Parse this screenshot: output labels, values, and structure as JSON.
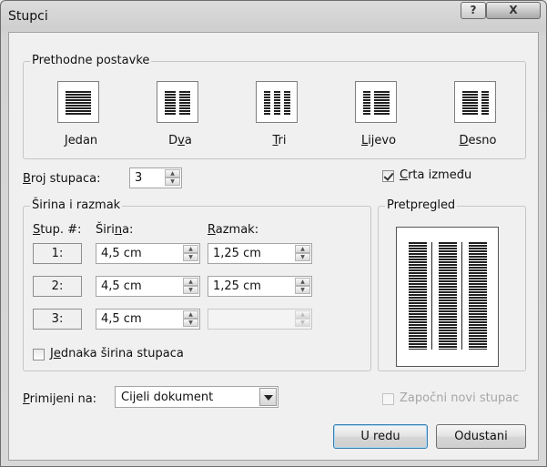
{
  "window": {
    "title": "Stupci",
    "help_icon": "?",
    "close_icon": "X"
  },
  "presets": {
    "label": "Prethodne postavke",
    "items": [
      {
        "label": "Jedan",
        "key": "J",
        "rest": "edan"
      },
      {
        "label": "Dva",
        "key": "v",
        "pre": "D",
        "rest": "a"
      },
      {
        "label": "Tri",
        "key": "T",
        "rest": "ri"
      },
      {
        "label": "Lijevo",
        "key": "L",
        "rest": "ijevo"
      },
      {
        "label": "Desno",
        "key": "D",
        "rest": "esno"
      }
    ]
  },
  "num_columns": {
    "label_key": "B",
    "label_rest": "roj stupaca:",
    "value": "3"
  },
  "line_between": {
    "label_key": "C",
    "label_rest": "rta između",
    "checked": true
  },
  "width_spacing": {
    "label": "Širina i razmak",
    "headers": {
      "col_key": "S",
      "col_rest": "tup. #:",
      "width_pre": "Širi",
      "width_key": "n",
      "width_rest": "a:",
      "spacing_key": "R",
      "spacing_rest": "azmak:"
    },
    "rows": [
      {
        "num": "1:",
        "width": "4,5 cm",
        "spacing": "1,25 cm"
      },
      {
        "num": "2:",
        "width": "4,5 cm",
        "spacing": "1,25 cm"
      },
      {
        "num": "3:",
        "width": "4,5 cm",
        "spacing": ""
      }
    ],
    "equal_width": {
      "pre": "J",
      "key": "e",
      "rest": "dnaka širina stupaca",
      "checked": false
    }
  },
  "preview": {
    "label": "Pretpregled"
  },
  "apply_to": {
    "label_key": "P",
    "label_rest": "rimijeni na:",
    "value": "Cijeli dokument"
  },
  "start_new_column": {
    "label": "Započni novi stupac",
    "checked": false
  },
  "buttons": {
    "ok": "U redu",
    "cancel": "Odustani"
  }
}
